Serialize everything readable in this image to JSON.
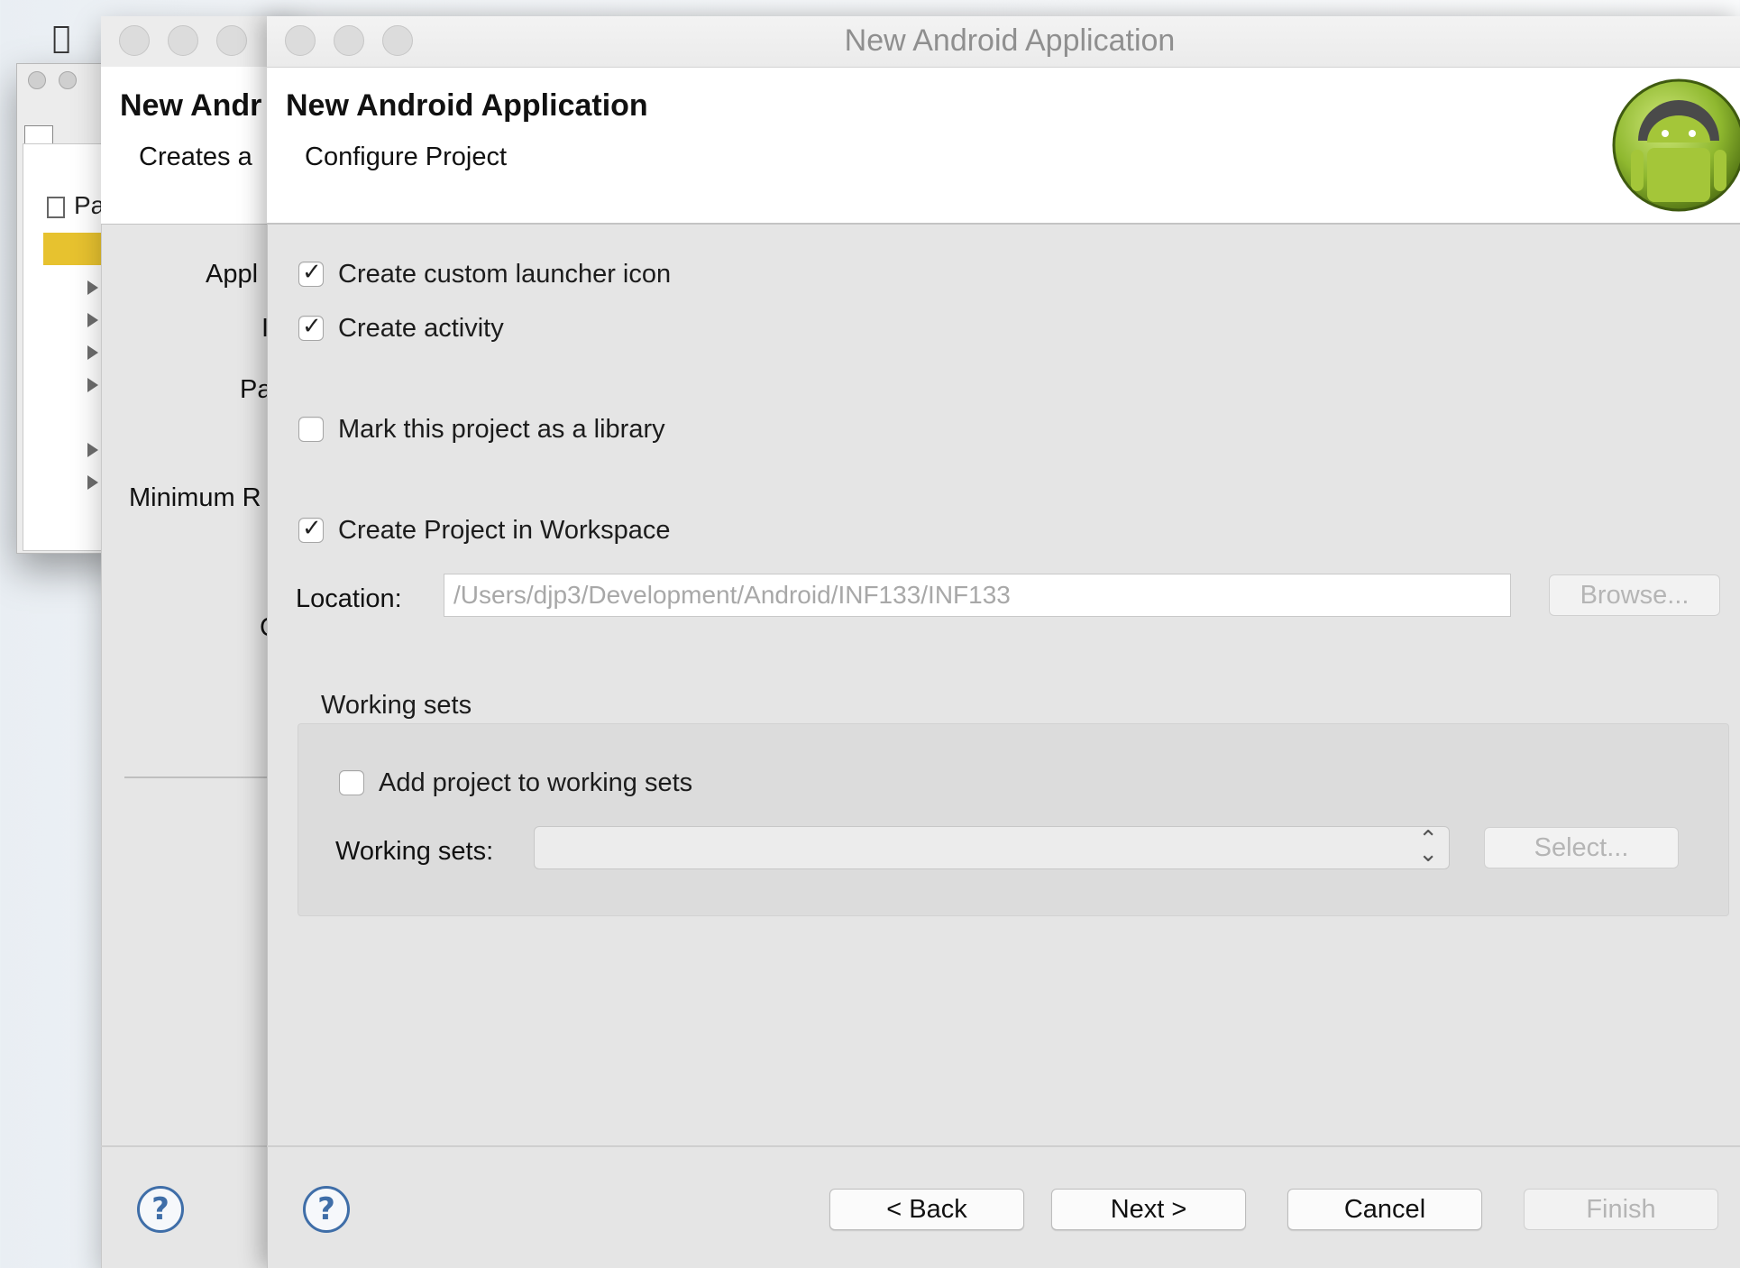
{
  "background_window": {
    "apple_icon": "apple-icon",
    "tree_label": "Pa"
  },
  "middle_dialog": {
    "title": "New Andr",
    "subtitle": "Creates a",
    "fields": [
      "Appl",
      "I",
      "Pa",
      "Minimum R",
      "C"
    ]
  },
  "dialog": {
    "window_title": "New Android Application",
    "header_title": "New Android Application",
    "header_subtitle": "Configure Project",
    "logo_icon": "android-logo-icon",
    "options": [
      {
        "label": "Create custom launcher icon",
        "checked": true
      },
      {
        "label": "Create activity",
        "checked": true
      },
      {
        "label": "Mark this project as a library",
        "checked": false
      },
      {
        "label": "Create Project in Workspace",
        "checked": true
      }
    ],
    "location_label": "Location:",
    "location_value": "/Users/djp3/Development/Android/INF133/INF133",
    "browse_label": "Browse...",
    "working_sets": {
      "group_label": "Working sets",
      "add_label": "Add project to working sets",
      "add_checked": false,
      "sets_label": "Working sets:",
      "sets_value": "",
      "select_label": "Select..."
    },
    "buttons": {
      "back": "< Back",
      "next": "Next >",
      "cancel": "Cancel",
      "finish": "Finish"
    },
    "help_icon": "?"
  },
  "colors": {
    "help_blue": "#3f6ea8",
    "android_green": "#a4c639",
    "selection_yellow": "#e7c22f"
  }
}
